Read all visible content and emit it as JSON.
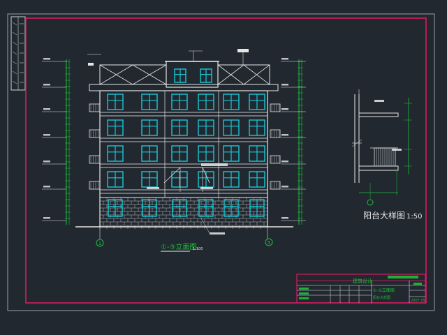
{
  "drawing": {
    "elevation_title": "①-⑤立面图",
    "elevation_scale": "1:100",
    "balcony_title": "阳台大样图",
    "balcony_scale": "1:50",
    "axis_left": "1",
    "axis_right": "5",
    "titleblock": {
      "design": "建筑设计",
      "sheet_name": "①-⑤立面图",
      "sheet_sub": "阳台大样图",
      "number": "2007.05"
    }
  },
  "colors": {
    "background": "#212830",
    "frame": "#d81b60",
    "lines": "#e6e6e6",
    "windows": "#19c8d8",
    "dims": "#1fbf3a",
    "text": "#ffffff"
  }
}
